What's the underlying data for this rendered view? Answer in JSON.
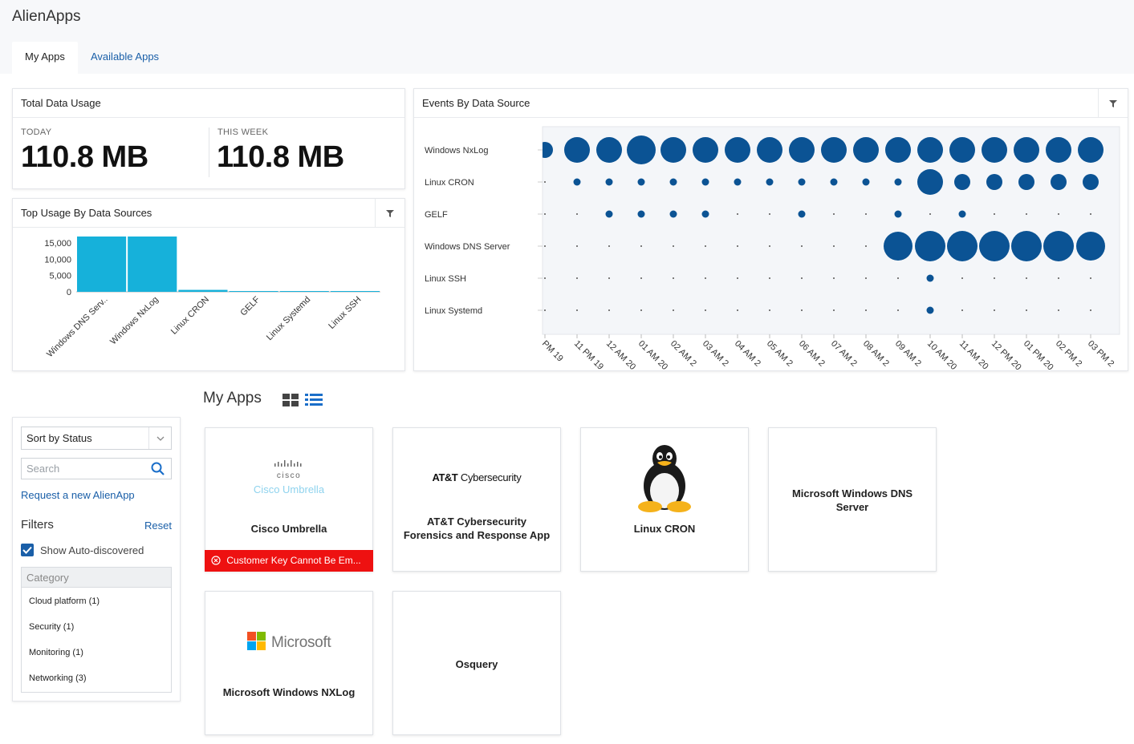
{
  "header": {
    "app_title": "AlienApps",
    "tabs": [
      {
        "label": "My Apps",
        "active": true
      },
      {
        "label": "Available Apps",
        "active": false
      }
    ]
  },
  "total_usage": {
    "title": "Total Data Usage",
    "today_label": "TODAY",
    "today_value": "110.8 MB",
    "week_label": "THIS WEEK",
    "week_value": "110.8 MB"
  },
  "top_usage": {
    "title": "Top Usage By Data Sources",
    "chart_data": {
      "type": "bar",
      "categories": [
        "Windows DNS Serv..",
        "Windows NxLog",
        "Linux CRON",
        "GELF",
        "Linux Systemd",
        "Linux SSH"
      ],
      "values": [
        17000,
        17000,
        600,
        100,
        100,
        100
      ],
      "ylim": [
        0,
        17000
      ],
      "yticks": [
        0,
        5000,
        10000,
        15000
      ],
      "ytick_labels": [
        "0",
        "5,000",
        "10,000",
        "15,000"
      ],
      "color": "#16b1da"
    }
  },
  "events": {
    "title": "Events By Data Source",
    "chart_data": {
      "type": "scatter",
      "rows": [
        "Windows NxLog",
        "Linux CRON",
        "GELF",
        "Windows DNS Server",
        "Linux SSH",
        "Linux Systemd"
      ],
      "x_labels": [
        "PM 19",
        "11 PM 19",
        "12 AM 20",
        "01 AM 20",
        "02 AM 2",
        "03 AM 2",
        "04 AM 2",
        "05 AM 2",
        "06 AM 2",
        "07 AM 2",
        "08 AM 2",
        "09 AM 2",
        "10 AM 20",
        "11 AM 20",
        "12 PM 20",
        "01 PM 20",
        "02 PM 2",
        "03 PM 2"
      ],
      "sizes": [
        [
          2,
          3,
          3,
          4,
          3,
          3,
          3,
          3,
          3,
          3,
          3,
          3,
          3,
          3,
          3,
          3,
          3,
          3
        ],
        [
          0,
          1,
          1,
          1,
          1,
          1,
          1,
          1,
          1,
          1,
          1,
          1,
          3,
          2,
          2,
          2,
          2,
          2
        ],
        [
          0,
          0,
          1,
          1,
          1,
          1,
          0,
          0,
          1,
          0,
          0,
          1,
          0,
          1,
          0,
          0,
          0,
          0
        ],
        [
          0,
          0,
          0,
          0,
          0,
          0,
          0,
          0,
          0,
          0,
          0,
          4,
          5,
          5,
          5,
          5,
          5,
          4
        ],
        [
          0,
          0,
          0,
          0,
          0,
          0,
          0,
          0,
          0,
          0,
          0,
          0,
          1,
          0,
          0,
          0,
          0,
          0
        ],
        [
          0,
          0,
          0,
          0,
          0,
          0,
          0,
          0,
          0,
          0,
          0,
          0,
          1,
          0,
          0,
          0,
          0,
          0
        ]
      ],
      "size_scale": "relative 0-5",
      "color": "#0b5394"
    }
  },
  "my_apps": {
    "title": "My Apps",
    "sort_label": "Sort by Status",
    "search_placeholder": "Search",
    "request_link": "Request a new AlienApp",
    "filters_label": "Filters",
    "reset_label": "Reset",
    "show_auto_label": "Show Auto-discovered",
    "show_auto_checked": true,
    "category_header": "Category",
    "categories": [
      "Cloud platform (1)",
      "Security (1)",
      "Monitoring (1)",
      "Networking (3)"
    ],
    "apps": [
      {
        "name": "Cisco Umbrella",
        "logo_top": "cisco",
        "logo_sub": "Cisco Umbrella",
        "error": "Customer Key Cannot Be Em..."
      },
      {
        "name": "AT&T Cybersecurity Forensics and Response App",
        "logo_bold": "AT&T",
        "logo_light": "Cybersecurity"
      },
      {
        "name": "Linux CRON"
      },
      {
        "name": "Microsoft Windows DNS Server"
      },
      {
        "name": "Microsoft Windows NXLog",
        "logo_text": "Microsoft"
      },
      {
        "name": "Osquery"
      }
    ]
  }
}
